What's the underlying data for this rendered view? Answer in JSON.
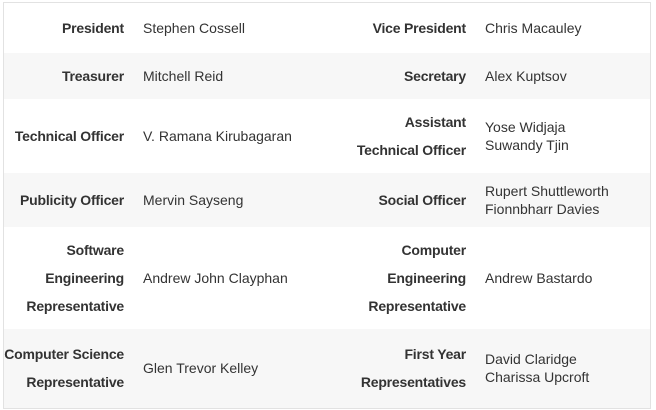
{
  "rows": [
    {
      "left_role": [
        "President"
      ],
      "left_names": [
        "Stephen Cossell"
      ],
      "right_role": [
        "Vice President"
      ],
      "right_names": [
        "Chris Macauley"
      ]
    },
    {
      "left_role": [
        "Treasurer"
      ],
      "left_names": [
        "Mitchell Reid"
      ],
      "right_role": [
        "Secretary"
      ],
      "right_names": [
        "Alex Kuptsov"
      ]
    },
    {
      "left_role": [
        "Technical Officer"
      ],
      "left_names": [
        "V. Ramana Kirubagaran"
      ],
      "right_role": [
        "Assistant",
        "Technical Officer"
      ],
      "right_names": [
        "Yose Widjaja",
        "Suwandy Tjin"
      ]
    },
    {
      "left_role": [
        "Publicity Officer"
      ],
      "left_names": [
        "Mervin Sayseng"
      ],
      "right_role": [
        "Social Officer"
      ],
      "right_names": [
        "Rupert Shuttleworth",
        "Fionnbharr Davies"
      ]
    },
    {
      "left_role": [
        "Software",
        "Engineering",
        "Representative"
      ],
      "left_names": [
        "Andrew John Clayphan"
      ],
      "right_role": [
        "Computer",
        "Engineering",
        "Representative"
      ],
      "right_names": [
        "Andrew Bastardo"
      ]
    },
    {
      "left_role": [
        "Computer Science",
        "Representative"
      ],
      "left_names": [
        "Glen Trevor Kelley"
      ],
      "right_role": [
        "First Year",
        "Representatives"
      ],
      "right_names": [
        "David Claridge",
        "Charissa Upcroft"
      ]
    }
  ]
}
